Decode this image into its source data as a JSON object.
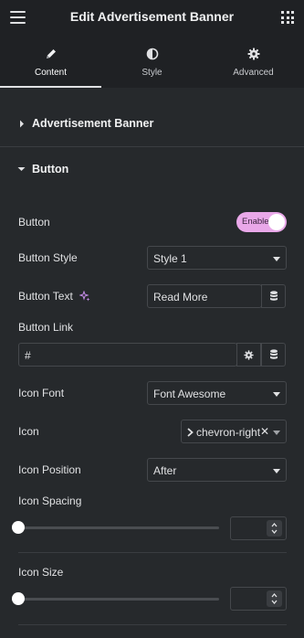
{
  "header": {
    "title": "Edit Advertisement Banner"
  },
  "tabs": [
    {
      "label": "Content",
      "icon": "pencil-icon",
      "active": true
    },
    {
      "label": "Style",
      "icon": "half-circle-icon",
      "active": false
    },
    {
      "label": "Advanced",
      "icon": "gear-icon",
      "active": false
    }
  ],
  "sections": {
    "advertisement_banner": {
      "label": "Advertisement Banner",
      "expanded": false
    },
    "button": {
      "label": "Button",
      "expanded": true
    }
  },
  "controls": {
    "button_toggle": {
      "label": "Button",
      "state": "Enable"
    },
    "button_style": {
      "label": "Button Style",
      "value": "Style 1"
    },
    "button_text": {
      "label": "Button Text",
      "value": "Read More"
    },
    "button_link": {
      "label": "Button Link",
      "value": "#"
    },
    "icon_font": {
      "label": "Icon Font",
      "value": "Font Awesome"
    },
    "icon": {
      "label": "Icon",
      "value": "chevron-right"
    },
    "icon_position": {
      "label": "Icon Position",
      "value": "After"
    },
    "icon_spacing": {
      "label": "Icon Spacing",
      "value": ""
    },
    "icon_size": {
      "label": "Icon Size",
      "value": ""
    }
  },
  "colors": {
    "background": "#26292c",
    "header_background": "#1f2124",
    "toggle_accent": "#e9a8e9"
  }
}
